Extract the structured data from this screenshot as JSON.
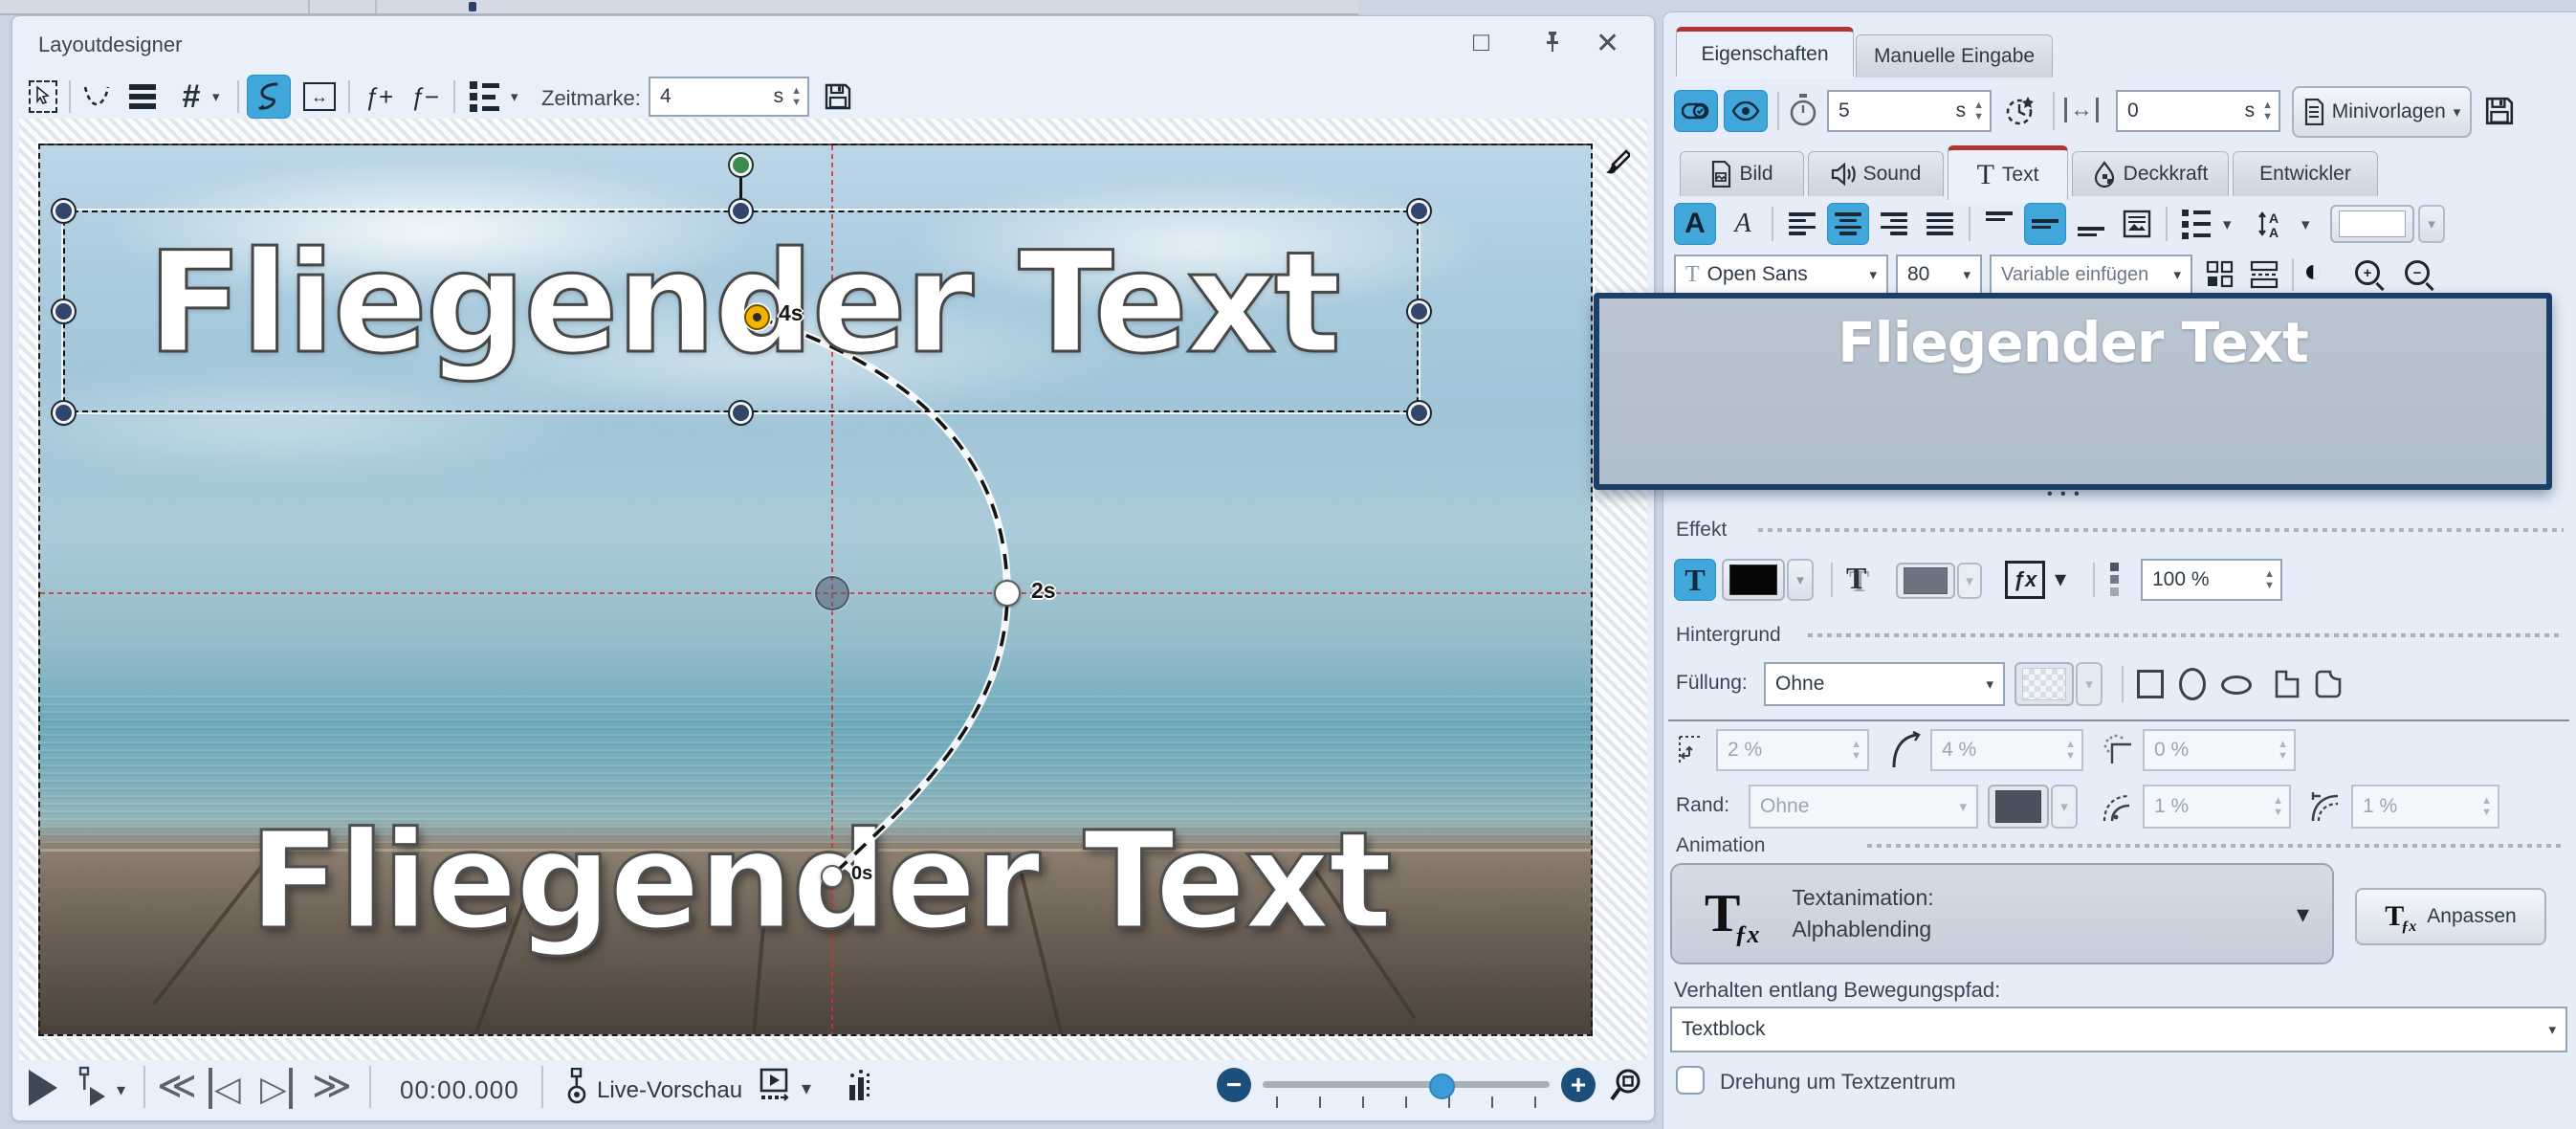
{
  "app": {
    "accent_blue": "#41a6da",
    "tab_red": "#b23432",
    "selection_navy": "#32456a",
    "keyframe_yellow": "#f2b400",
    "guide_red": "#cf3434"
  },
  "layoutdesigner": {
    "title": "Layoutdesigner",
    "toolbar": {
      "zeitmarke_label": "Zeitmarke:",
      "zeitmarke_value": "4",
      "zeitmarke_unit": "s"
    },
    "canvas": {
      "text_top": "Fliegender Text",
      "text_bottom": "Fliegender Text",
      "keyframes": [
        {
          "time": "4s"
        },
        {
          "time": "2s"
        },
        {
          "time": "0s"
        }
      ]
    },
    "transport": {
      "time": "00:00.000",
      "live_preview": "Live-Vorschau"
    }
  },
  "properties_panel": {
    "tabs": [
      {
        "label": "Eigenschaften"
      },
      {
        "label": "Manuelle Eingabe"
      }
    ],
    "duration": {
      "value": "5",
      "unit": "s"
    },
    "offset": {
      "value": "0",
      "unit": "s"
    },
    "minivorlagen_label": "Minivorlagen",
    "content_tabs": [
      {
        "label": "Bild"
      },
      {
        "label": "Sound"
      },
      {
        "label": "Text"
      },
      {
        "label": "Deckkraft"
      },
      {
        "label": "Entwickler"
      }
    ],
    "text_toolbar": {
      "font": "Open Sans",
      "size": "80",
      "variable": "Variable einfügen"
    },
    "editor": {
      "text": "Fliegender Text",
      "drag_dots": "• • •"
    },
    "effekt": {
      "header": "Effekt",
      "opacity": "100 %"
    },
    "hintergrund": {
      "header": "Hintergrund",
      "fuellung_label": "Füllung:",
      "fuellung_value": "Ohne",
      "innenabstand": "2 %",
      "ecken": "4 %",
      "weichzeichnen": "0 %",
      "rand_label": "Rand:",
      "rand_value": "Ohne",
      "rand_breite1": "1 %",
      "rand_breite2": "1 %"
    },
    "animation": {
      "header": "Animation",
      "dropdown_line1": "Textanimation:",
      "dropdown_line2": "Alphablending",
      "anpassen_label": "Anpassen",
      "verhalten_label": "Verhalten entlang Bewegungspfad:",
      "verhalten_value": "Textblock",
      "checkbox_label": "Drehung um Textzentrum"
    }
  },
  "icons": {
    "caret": "▾",
    "spin_up": "▲",
    "spin_down": "▼",
    "play": "▶",
    "rewind": "≪",
    "forward": "≫",
    "step_back": "◁",
    "step_fwd": "▷",
    "minus": "−",
    "plus": "+",
    "close": "✕",
    "maximize": "□",
    "contrast": "◐",
    "grid": "#",
    "width_arrows": "↔",
    "bold_a": "A",
    "italic_a": "A",
    "t_glyph": "T",
    "fx": "ƒx",
    "f_plus": "ƒ+",
    "f_minus": "ƒ−",
    "font_tt": "T"
  }
}
